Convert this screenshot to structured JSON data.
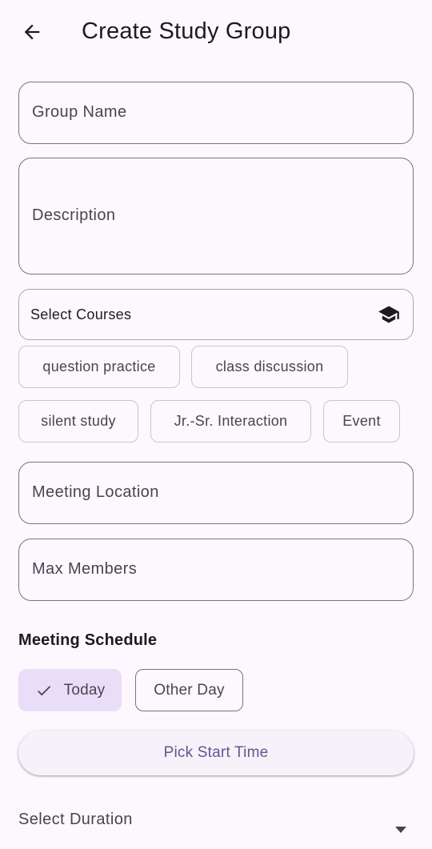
{
  "appbar": {
    "title": "Create Study Group",
    "back_icon": "arrow-back-icon"
  },
  "form": {
    "group_name": {
      "label": "Group Name",
      "value": ""
    },
    "description": {
      "label": "Description",
      "value": ""
    },
    "courses": {
      "label": "Select Courses",
      "icon": "school-icon"
    },
    "tags": [
      {
        "label": "question practice",
        "selected": false
      },
      {
        "label": "class discussion",
        "selected": false
      },
      {
        "label": "silent study",
        "selected": false
      },
      {
        "label": "Jr.-Sr. Interaction",
        "selected": false
      },
      {
        "label": "Event",
        "selected": false
      }
    ],
    "meeting_location": {
      "label": "Meeting Location",
      "value": ""
    },
    "max_members": {
      "label": "Max Members",
      "value": ""
    }
  },
  "schedule": {
    "title": "Meeting Schedule",
    "options": [
      {
        "label": "Today",
        "selected": true
      },
      {
        "label": "Other Day",
        "selected": false
      }
    ],
    "pick_time_label": "Pick Start Time",
    "duration": {
      "label": "Select Duration",
      "icon": "dropdown-arrow-icon"
    }
  },
  "colors": {
    "background": "#fdf7fe",
    "primary": "#65558f",
    "selected_chip": "#e8def8",
    "outline": "#79747e"
  }
}
